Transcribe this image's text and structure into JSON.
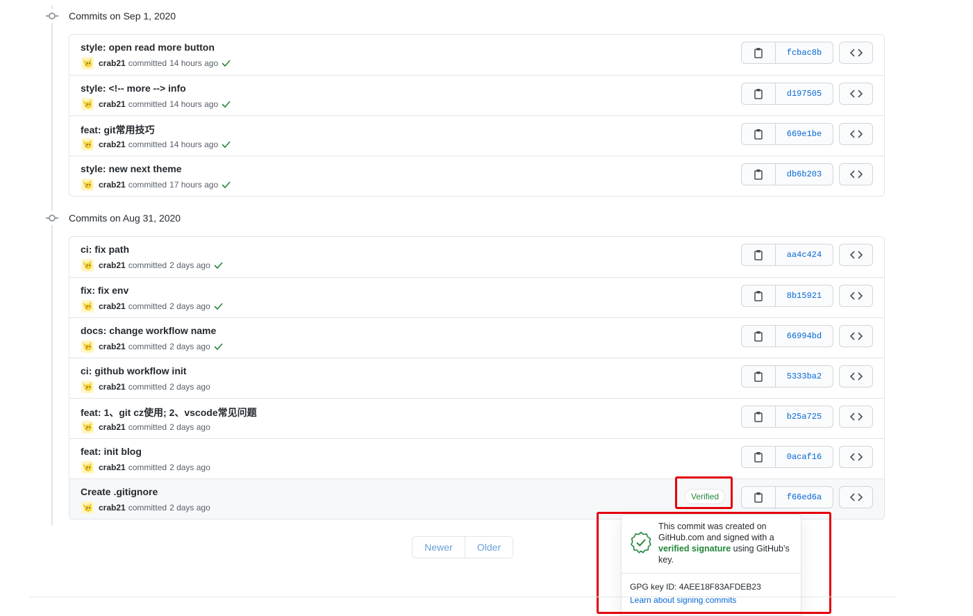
{
  "groups": [
    {
      "title": "Commits on Sep 1, 2020",
      "commits": [
        {
          "title": "style: open read more button",
          "author": "crab21",
          "action": "committed",
          "time": "14 hours ago",
          "status": "success",
          "sha": "fcbac8b"
        },
        {
          "title": "style: <!-- more --> info",
          "author": "crab21",
          "action": "committed",
          "time": "14 hours ago",
          "status": "success",
          "sha": "d197505"
        },
        {
          "title": "feat: git常用技巧",
          "author": "crab21",
          "action": "committed",
          "time": "14 hours ago",
          "status": "success",
          "sha": "669e1be"
        },
        {
          "title": "style: new next theme",
          "author": "crab21",
          "action": "committed",
          "time": "17 hours ago",
          "status": "success",
          "sha": "db6b203"
        }
      ]
    },
    {
      "title": "Commits on Aug 31, 2020",
      "commits": [
        {
          "title": "ci: fix path",
          "author": "crab21",
          "action": "committed",
          "time": "2 days ago",
          "status": "success",
          "sha": "aa4c424"
        },
        {
          "title": "fix: fix env",
          "author": "crab21",
          "action": "committed",
          "time": "2 days ago",
          "status": "success",
          "sha": "8b15921"
        },
        {
          "title": "docs: change workflow name",
          "author": "crab21",
          "action": "committed",
          "time": "2 days ago",
          "status": "success",
          "sha": "66994bd"
        },
        {
          "title": "ci: github workflow init",
          "author": "crab21",
          "action": "committed",
          "time": "2 days ago",
          "status": "",
          "sha": "5333ba2"
        },
        {
          "title": "feat: 1、git cz使用; 2、vscode常见问题",
          "author": "crab21",
          "action": "committed",
          "time": "2 days ago",
          "status": "",
          "sha": "b25a725"
        },
        {
          "title": "feat: init blog",
          "author": "crab21",
          "action": "committed",
          "time": "2 days ago",
          "status": "",
          "sha": "0acaf16"
        },
        {
          "title": "Create .gitignore",
          "author": "crab21",
          "action": "committed",
          "time": "2 days ago",
          "status": "",
          "sha": "f66ed6a",
          "badge": "Verified"
        }
      ]
    }
  ],
  "popover": {
    "text_before": "This commit was created on GitHub.com and signed with a ",
    "highlight": "verified signature",
    "text_after": " using GitHub’s key.",
    "gpg_label": "GPG key ID:",
    "gpg_key": "4AEE18F83AFDEB23",
    "learn_link": "Learn about signing commits"
  },
  "pagination": {
    "newer": "Newer",
    "older": "Older"
  },
  "colors": {
    "link": "#0366d6",
    "success": "#22863a",
    "annotation": "#e3000b",
    "border": "#e1e4e8"
  },
  "icons": {
    "copy": "clipboard-icon",
    "browse": "code-icon",
    "status": "check-icon",
    "verified": "verified-check-icon"
  }
}
